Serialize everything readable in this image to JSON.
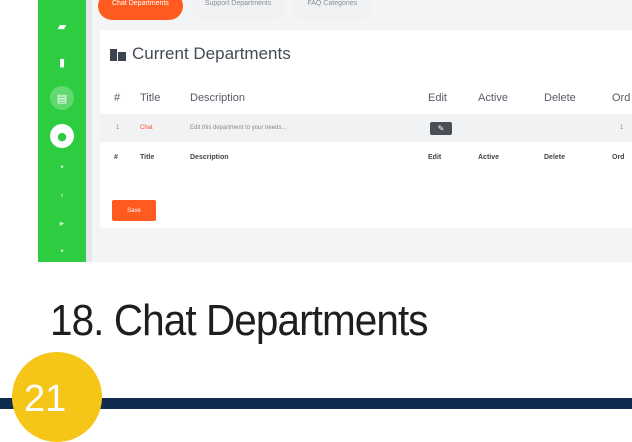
{
  "tabs": [
    {
      "label": "Chat Departments",
      "active": true
    },
    {
      "label": "Support Departments",
      "active": false
    },
    {
      "label": "FAQ Categories",
      "active": false
    }
  ],
  "card": {
    "title": "Current Departments"
  },
  "table": {
    "headers": [
      "#",
      "Title",
      "Description",
      "Edit",
      "Active",
      "Delete",
      "Ord"
    ],
    "rows": [
      {
        "num": "1",
        "title": "Chat",
        "description": "Edit this department to your needs...",
        "order": "1"
      }
    ],
    "footer_headers": [
      "#",
      "Title",
      "Description",
      "Edit",
      "Active",
      "Delete",
      "Ord"
    ]
  },
  "save_label": "Save",
  "heading": "18. Chat Departments",
  "badge_number": "21",
  "colors": {
    "sidebar": "#2ecc40",
    "accent": "#ff5a1f",
    "bottom_bar": "#0f2b50",
    "badge": "#f5c518"
  },
  "sidebar_icons": [
    "file-icon",
    "document-icon",
    "list-icon",
    "chat-icon",
    "dot-icon",
    "chevron-icon",
    "arrow-icon",
    "dot-icon"
  ]
}
